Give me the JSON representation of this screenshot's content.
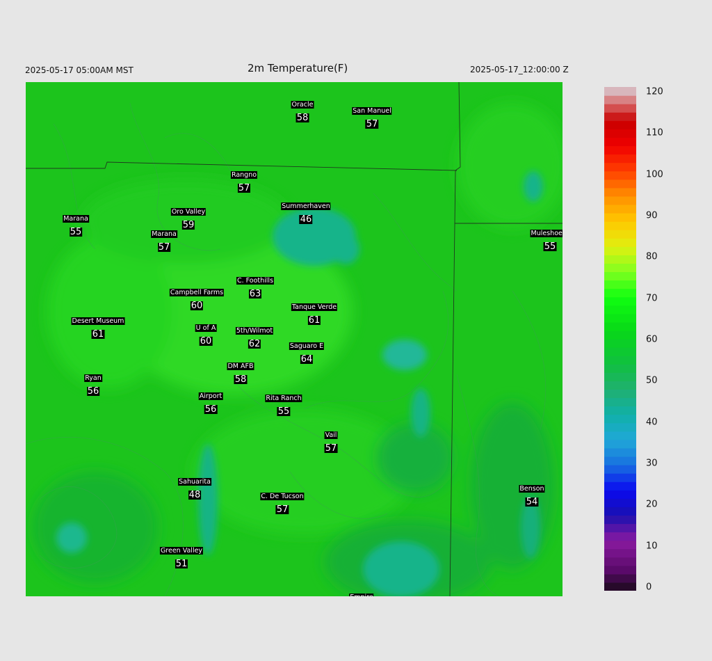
{
  "header": {
    "valid_local": "2025-05-17 05:00AM MST",
    "title": "2m Temperature(F)",
    "valid_utc": "2025-05-17_12:00:00 Z"
  },
  "map": {
    "variable": "2m Temperature",
    "units": "F",
    "stations": [
      {
        "name": "Oracle",
        "value": "58"
      },
      {
        "name": "San Manuel",
        "value": "57"
      },
      {
        "name": "Rangno",
        "value": "57"
      },
      {
        "name": "Summerhaven",
        "value": "46"
      },
      {
        "name": "Marana",
        "value": "55"
      },
      {
        "name": "Oro Valley",
        "value": "59"
      },
      {
        "name": "Marana",
        "value": "57"
      },
      {
        "name": "Muleshoe R",
        "value": "55"
      },
      {
        "name": "C. Foothills",
        "value": "63"
      },
      {
        "name": "Campbell Farms",
        "value": "60"
      },
      {
        "name": "Tanque Verde",
        "value": "61"
      },
      {
        "name": "Desert Museum",
        "value": "61"
      },
      {
        "name": "U of A",
        "value": "60"
      },
      {
        "name": "5th/Wilmot",
        "value": "62"
      },
      {
        "name": "Saguaro E",
        "value": "64"
      },
      {
        "name": "DM AFB",
        "value": "58"
      },
      {
        "name": "Ryan",
        "value": "56"
      },
      {
        "name": "Airport",
        "value": "56"
      },
      {
        "name": "Rita Ranch",
        "value": "55"
      },
      {
        "name": "Vail",
        "value": "57"
      },
      {
        "name": "Sahuarita",
        "value": "48"
      },
      {
        "name": "C. De Tucson",
        "value": "57"
      },
      {
        "name": "Benson",
        "value": "54"
      },
      {
        "name": "Green Valley",
        "value": "51"
      },
      {
        "name": "Empire",
        "value": ""
      }
    ]
  },
  "colorbar": {
    "min": 0,
    "max": 120,
    "ticks": [
      "120",
      "110",
      "100",
      "90",
      "80",
      "70",
      "60",
      "50",
      "40",
      "30",
      "20",
      "10",
      "0"
    ],
    "stops": [
      {
        "v": 0,
        "c": "#1a0a1a"
      },
      {
        "v": 5,
        "c": "#5a0a6a"
      },
      {
        "v": 12,
        "c": "#8a1aa0"
      },
      {
        "v": 18,
        "c": "#1a10b0"
      },
      {
        "v": 24,
        "c": "#0a0af0"
      },
      {
        "v": 30,
        "c": "#1870e0"
      },
      {
        "v": 36,
        "c": "#20a8d8"
      },
      {
        "v": 42,
        "c": "#10b0a8"
      },
      {
        "v": 48,
        "c": "#20b070"
      },
      {
        "v": 54,
        "c": "#10c040"
      },
      {
        "v": 62,
        "c": "#08d818"
      },
      {
        "v": 70,
        "c": "#10ff10"
      },
      {
        "v": 76,
        "c": "#80ff20"
      },
      {
        "v": 82,
        "c": "#e0f010"
      },
      {
        "v": 88,
        "c": "#ffc800"
      },
      {
        "v": 94,
        "c": "#ff9000"
      },
      {
        "v": 100,
        "c": "#ff4000"
      },
      {
        "v": 106,
        "c": "#f00000"
      },
      {
        "v": 112,
        "c": "#c80000"
      },
      {
        "v": 116,
        "c": "#d86868"
      },
      {
        "v": 120,
        "c": "#d8d0d8"
      }
    ]
  }
}
